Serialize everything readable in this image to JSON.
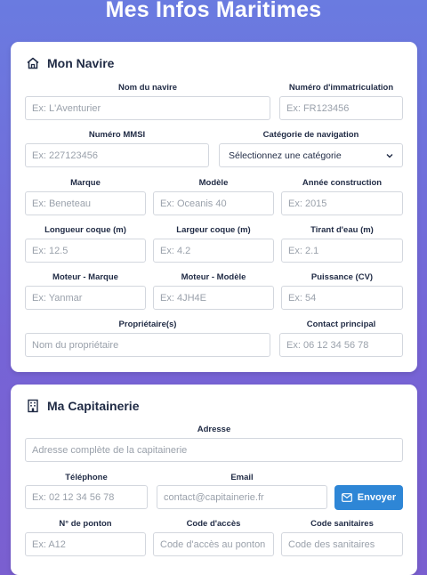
{
  "page": {
    "title": "Mes Infos Maritimes"
  },
  "navire": {
    "header": "Mon Navire",
    "nom_label": "Nom du navire",
    "nom_placeholder": "Ex: L'Aventurier",
    "immat_label": "Numéro d'immatriculation",
    "immat_placeholder": "Ex: FR123456",
    "mmsi_label": "Numéro MMSI",
    "mmsi_placeholder": "Ex: 227123456",
    "categorie_label": "Catégorie de navigation",
    "categorie_value": "Sélectionnez une catégorie",
    "marque_label": "Marque",
    "marque_placeholder": "Ex: Beneteau",
    "modele_label": "Modèle",
    "modele_placeholder": "Ex: Oceanis 40",
    "annee_label": "Année construction",
    "annee_placeholder": "Ex: 2015",
    "longueur_label": "Longueur coque (m)",
    "longueur_placeholder": "Ex: 12.5",
    "largeur_label": "Largeur coque (m)",
    "largeur_placeholder": "Ex: 4.2",
    "tirant_label": "Tirant d'eau (m)",
    "tirant_placeholder": "Ex: 2.1",
    "moteur_marque_label": "Moteur - Marque",
    "moteur_marque_placeholder": "Ex: Yanmar",
    "moteur_modele_label": "Moteur - Modèle",
    "moteur_modele_placeholder": "Ex: 4JH4E",
    "puissance_label": "Puissance (CV)",
    "puissance_placeholder": "Ex: 54",
    "proprietaire_label": "Propriétaire(s)",
    "proprietaire_placeholder": "Nom du propriétaire",
    "contact_label": "Contact principal",
    "contact_placeholder": "Ex: 06 12 34 56 78"
  },
  "capitainerie": {
    "header": "Ma Capitainerie",
    "adresse_label": "Adresse",
    "adresse_placeholder": "Adresse complète de la capitainerie",
    "telephone_label": "Téléphone",
    "telephone_placeholder": "Ex: 02 12 34 56 78",
    "email_label": "Email",
    "email_placeholder": "contact@capitainerie.fr",
    "send_label": "Envoyer",
    "ponton_label": "N° de ponton",
    "ponton_placeholder": "Ex: A12",
    "code_acces_label": "Code d'accès",
    "code_acces_placeholder": "Code d'accès au ponton",
    "code_sanitaires_label": "Code sanitaires",
    "code_sanitaires_placeholder": "Code des sanitaires"
  },
  "colors": {
    "accent": "#2e86d6",
    "background_top": "#6a7be0",
    "background_bottom": "#7a5fd0"
  },
  "icons": {
    "navire": "home-icon",
    "capitainerie": "building-icon",
    "send": "envelope-icon",
    "select": "chevron-down-icon"
  }
}
